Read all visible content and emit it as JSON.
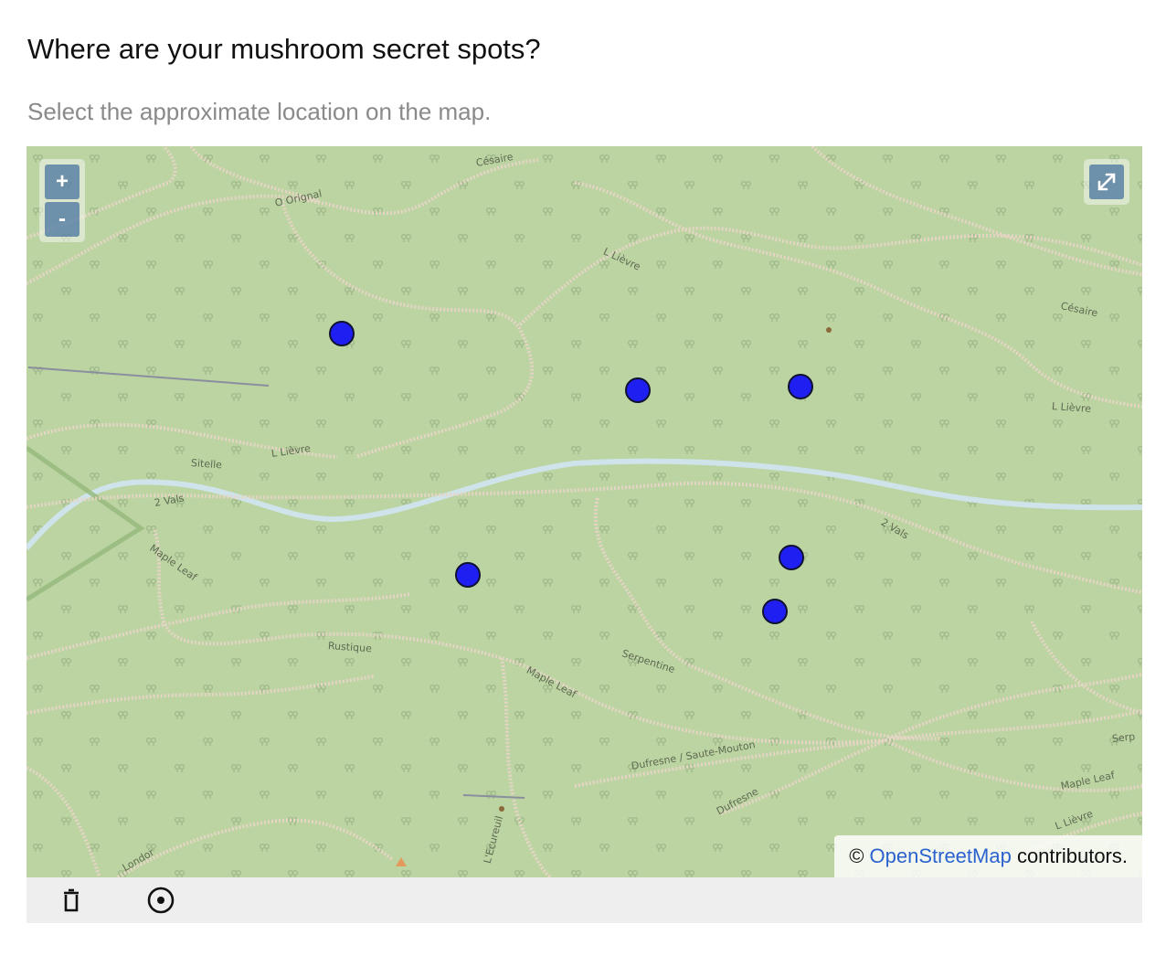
{
  "question": {
    "title": "Where are your mushroom secret spots?",
    "description": "Select the approximate location on the map."
  },
  "map": {
    "controls": {
      "zoom_in": "+",
      "zoom_out": "-",
      "fullscreen_icon": "expand-icon"
    },
    "attribution": {
      "prefix": "© ",
      "link_text": "OpenStreetMap",
      "suffix": " contributors."
    },
    "colors": {
      "land": "#bcd3a2",
      "trail": "#e8d6c6",
      "river": "#cfe3ea",
      "marker": "#1f1ff2"
    },
    "trail_labels": [
      "Césaire",
      "O Orignal",
      "L Lièvre",
      "Césaire",
      "L Lièvre",
      "Sitelle",
      "L Lièvre",
      "2 Vals",
      "Maple Leaf",
      "2 Vals",
      "Rustique",
      "Serpentine",
      "Maple Leaf",
      "Dufresne / Saute-Mouton",
      "Dufresne",
      "Maple Leaf",
      "L Lièvre",
      "Londor",
      "L'Ecureuil",
      "Serp"
    ],
    "marker_count": 6
  },
  "toolbar": {
    "delete_icon": "trash-icon",
    "point_icon": "draw-point-icon"
  }
}
